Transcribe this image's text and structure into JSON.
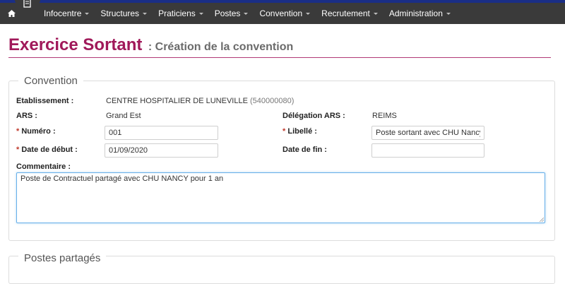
{
  "nav": {
    "items": [
      {
        "label": "Infocentre"
      },
      {
        "label": "Structures"
      },
      {
        "label": "Praticiens"
      },
      {
        "label": "Postes"
      },
      {
        "label": "Convention"
      },
      {
        "label": "Recrutement"
      },
      {
        "label": "Administration"
      }
    ],
    "home_icon": "home-icon",
    "logo_icon": "document-icon"
  },
  "page": {
    "title": "Exercice Sortant",
    "subtitle": ": Création de la convention"
  },
  "convention": {
    "legend": "Convention",
    "etablissement_label": "Etablissement :",
    "etablissement_value": "CENTRE HOSPITALIER DE LUNEVILLE",
    "etablissement_code": "(540000080)",
    "ars_label": "ARS :",
    "ars_value": "Grand Est",
    "delegation_label": "Délégation ARS :",
    "delegation_value": "REIMS",
    "numero_label": "Numéro :",
    "numero_value": "001",
    "libelle_label": "Libellé :",
    "libelle_value": "Poste sortant avec CHU Nancy",
    "date_debut_label": "Date de début :",
    "date_debut_value": "01/09/2020",
    "date_fin_label": "Date de fin :",
    "date_fin_value": "",
    "commentaire_label": "Commentaire :",
    "commentaire_value": "Poste de Contractuel partagé avec CHU NANCY pour 1 an",
    "required_mark": "*"
  },
  "postes": {
    "legend": "Postes partagés"
  },
  "colors": {
    "title": "#a0195a",
    "subtitle": "#6b6b6b",
    "navbar": "#3a3a3a",
    "topstrip": "#1a2e86"
  }
}
